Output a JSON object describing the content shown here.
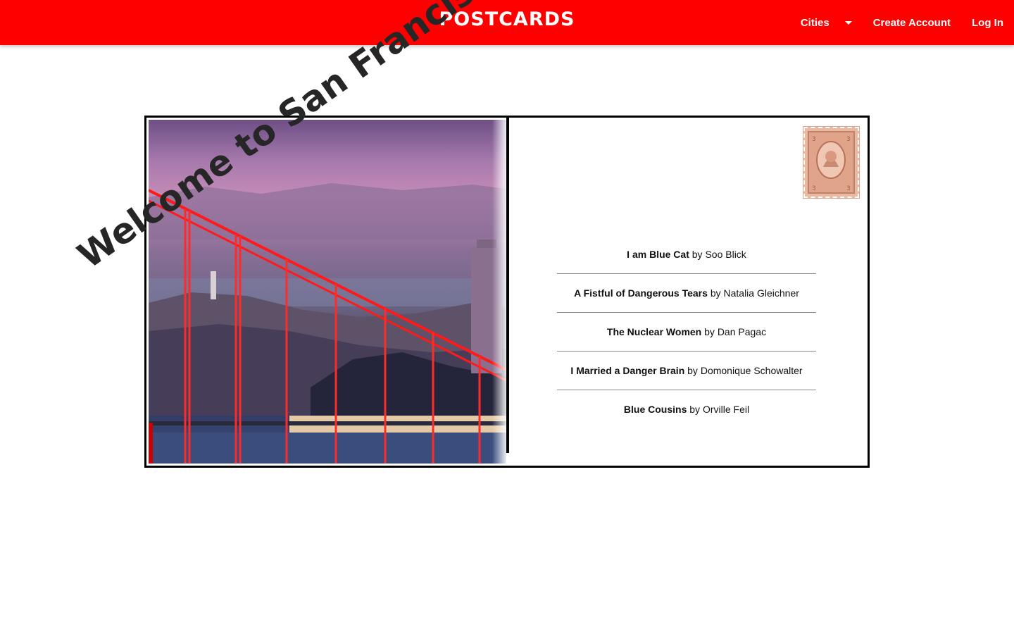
{
  "header": {
    "brand": "POSTCARDS",
    "nav": {
      "cities_label": "Cities",
      "create_account_label": "Create Account",
      "login_label": "Log In"
    },
    "colors": {
      "background": "#ff0000",
      "text": "#ffffff"
    }
  },
  "postcard": {
    "welcome_text": "Welcome to San Francisco",
    "stamp": "postage-stamp",
    "stories": [
      {
        "title": "I am Blue Cat",
        "by": "by",
        "author": "Soo Blick"
      },
      {
        "title": "A Fistful of Dangerous Tears",
        "by": "by",
        "author": "Natalia Gleichner"
      },
      {
        "title": "The Nuclear Women",
        "by": "by",
        "author": "Dan Pagac"
      },
      {
        "title": "I Married a Danger Brain",
        "by": "by",
        "author": "Domonique Schowalter"
      },
      {
        "title": "Blue Cousins",
        "by": "by",
        "author": "Orville Feil"
      }
    ]
  }
}
